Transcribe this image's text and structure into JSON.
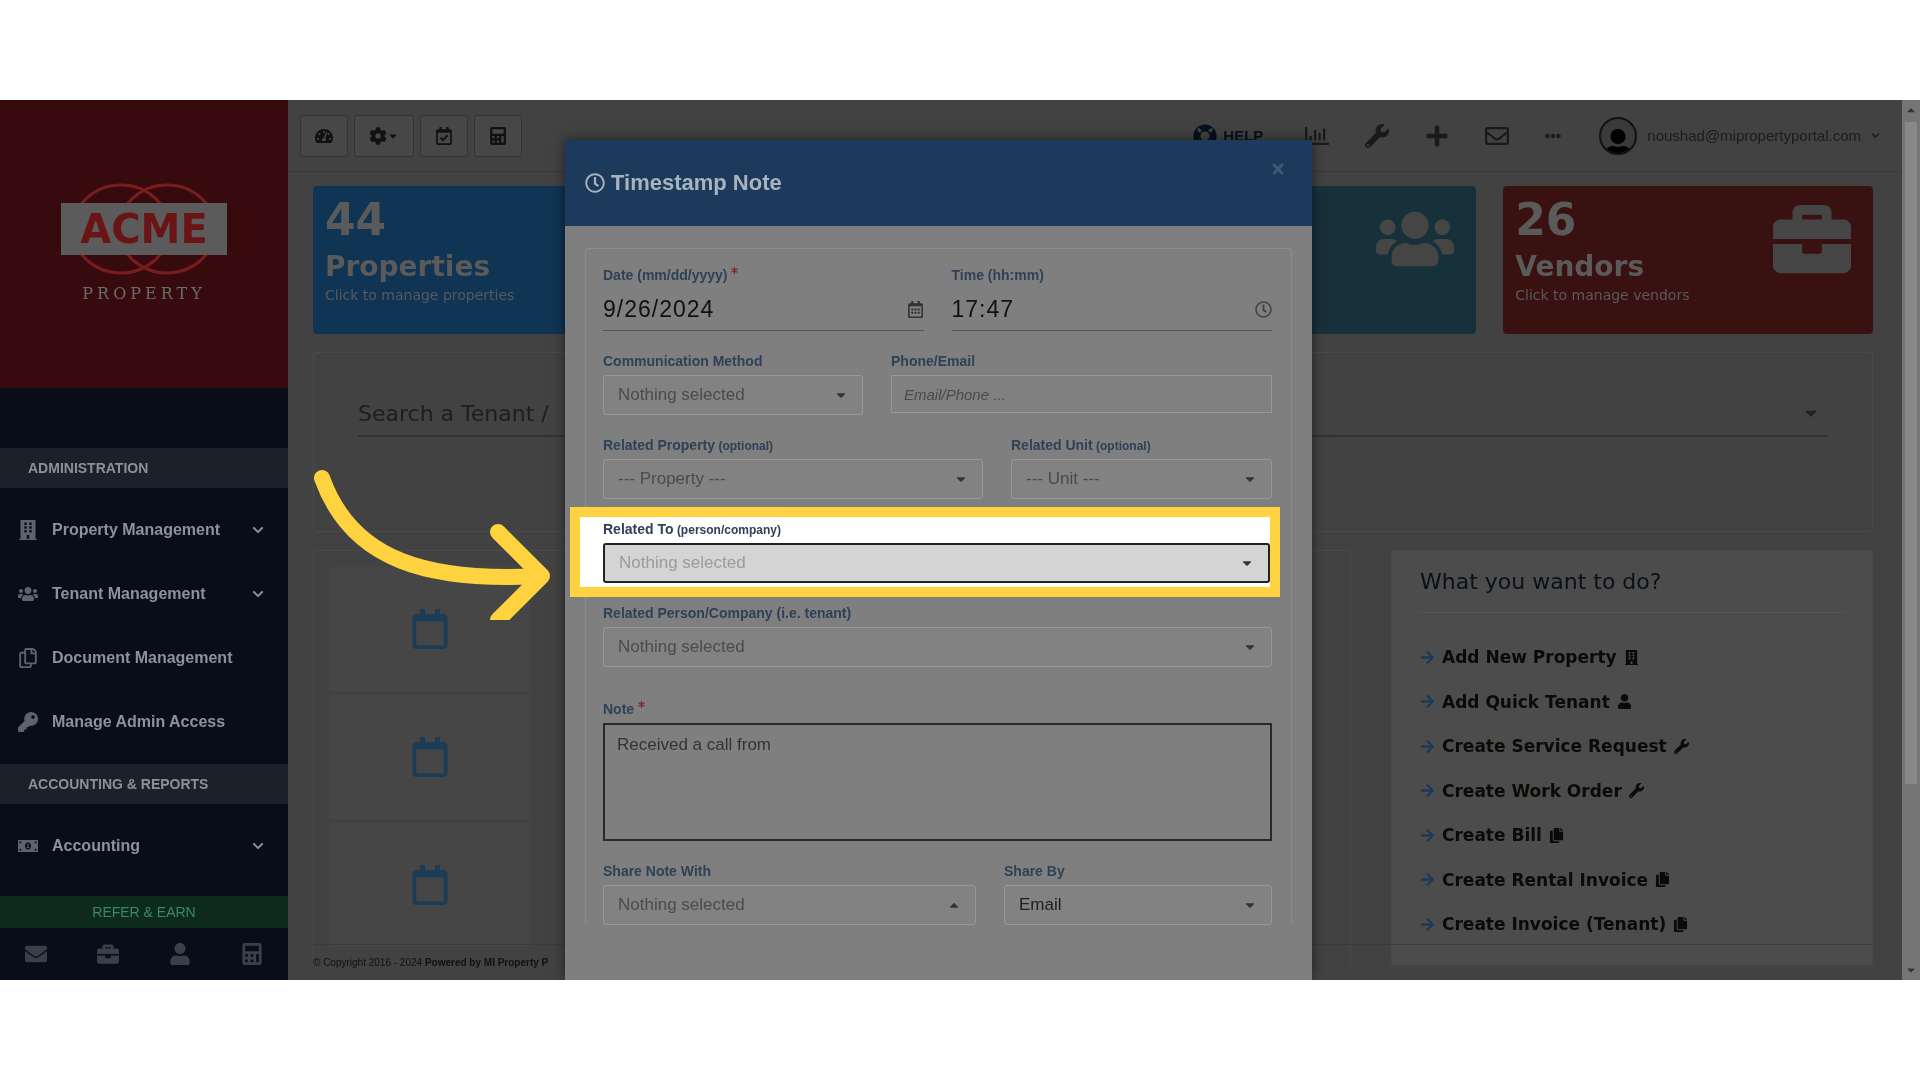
{
  "sidebar": {
    "logo": {
      "name": "ACME",
      "tagline": "PROPERTY"
    },
    "sections": [
      {
        "heading": "ADMINISTRATION",
        "items": [
          {
            "label": "Property Management",
            "kind": "building",
            "expandable": true
          },
          {
            "label": "Tenant Management",
            "kind": "people",
            "expandable": true
          },
          {
            "label": "Document Management",
            "kind": "documents",
            "expandable": false
          },
          {
            "label": "Manage Admin Access",
            "kind": "key",
            "expandable": false
          }
        ]
      },
      {
        "heading": "ACCOUNTING & REPORTS",
        "items": [
          {
            "label": "Accounting",
            "kind": "money",
            "expandable": true
          }
        ]
      }
    ],
    "refer_button": "REFER & EARN"
  },
  "top_bar": {
    "help": "HELP",
    "user": "noushad@mipropertyportal.com"
  },
  "stat_cards": [
    {
      "kind": "properties",
      "count": "44",
      "title": "Properties",
      "subtitle": "Click to manage properties",
      "color": "#0f3454"
    },
    {
      "kind": "tenants",
      "color": "#17313b"
    },
    {
      "kind": "vendors",
      "count": "26",
      "title": "Vendors",
      "subtitle": "Click to manage vendors",
      "color": "#391110"
    }
  ],
  "search": {
    "placeholder": "Search a Tenant /"
  },
  "quick_actions": {
    "title": "What you want to do?",
    "items": [
      {
        "label": "Add New Property",
        "kind": "building"
      },
      {
        "label": "Add Quick Tenant",
        "kind": "person"
      },
      {
        "label": "Create Service Request",
        "kind": "wrench"
      },
      {
        "label": "Create Work Order",
        "kind": "wrench"
      },
      {
        "label": "Create Bill",
        "kind": "copy"
      },
      {
        "label": "Create Rental Invoice",
        "kind": "copy"
      },
      {
        "label": "Create Invoice (Tenant)",
        "kind": "copy"
      }
    ]
  },
  "footer": "© Copyright 2016 - 2024 **Powered by MI Property P**",
  "modal": {
    "title": "Timestamp Note",
    "rows": [
      [
        {
          "kind": "date",
          "label": "Date (mm/dd/yyyy)",
          "required": true,
          "value": "9/26/2024"
        },
        {
          "kind": "time",
          "label": "Time (hh:mm)",
          "required": false,
          "value": "17:47"
        }
      ],
      [
        {
          "kind": "select",
          "label": "Communication Method",
          "required": false,
          "value": "Nothing selected",
          "expanded": false
        },
        {
          "kind": "input",
          "label": "Phone/Email",
          "required": false,
          "placeholder": "Email/Phone ..."
        }
      ],
      [
        {
          "kind": "select",
          "label": "Related Property",
          "hint": "(optional)",
          "required": false,
          "value": "--- Property ---",
          "expanded": false
        },
        {
          "kind": "select",
          "label": "Related Unit",
          "hint": "(optional)",
          "required": false,
          "value": "--- Unit ---",
          "expanded": false
        }
      ],
      [
        {
          "kind": "select",
          "label": "Related To",
          "hint": "(person/company)",
          "required": false,
          "value": "Nothing selected",
          "expanded": false,
          "highlighted": true
        }
      ],
      [
        {
          "kind": "select",
          "label": "Related Person/Company (i.e. tenant)",
          "required": false,
          "value": "Nothing selected",
          "expanded": false
        }
      ],
      [
        {
          "kind": "textarea",
          "label": "Note",
          "required": true,
          "value": "Received a call from"
        }
      ],
      [
        {
          "kind": "select",
          "label": "Share Note With",
          "required": false,
          "value": "Nothing selected",
          "expanded": true
        },
        {
          "kind": "select",
          "label": "Share By",
          "required": false,
          "value": "Email",
          "filled": true,
          "expanded": false
        }
      ]
    ]
  }
}
